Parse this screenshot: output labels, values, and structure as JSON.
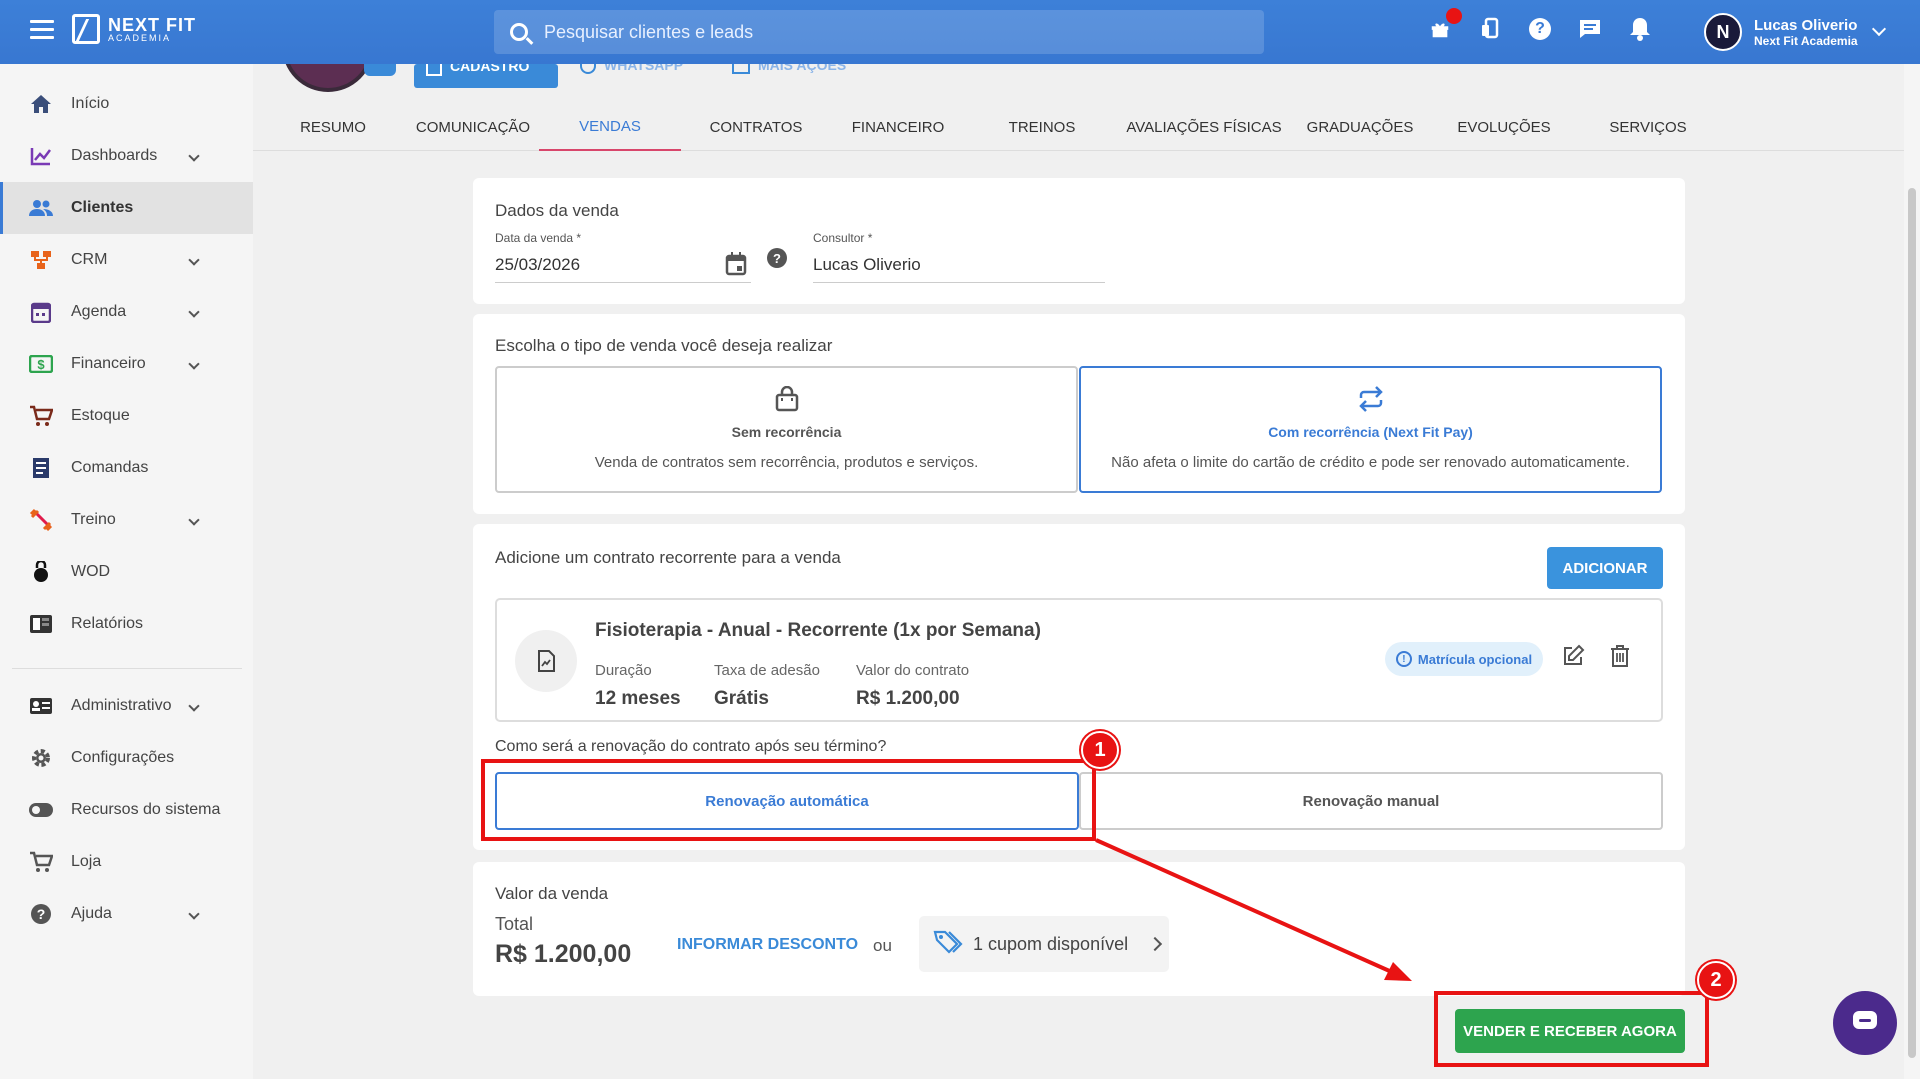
{
  "topbar": {
    "logo_line1": "NEXT FIT",
    "logo_line2": "ACADEMIA",
    "search_placeholder": "Pesquisar clientes e leads",
    "icons": [
      "gift-icon",
      "phone-icon",
      "help-icon",
      "chat-icon",
      "bell-icon"
    ],
    "user_name": "Lucas Oliverio",
    "user_org": "Next Fit Academia",
    "avatar_letter": "N",
    "accent": "#3a7bd5"
  },
  "sidebar": {
    "items": [
      {
        "label": "Início",
        "icon": "home-icon",
        "chevron": false
      },
      {
        "label": "Dashboards",
        "icon": "chart-icon",
        "chevron": true
      },
      {
        "label": "Clientes",
        "icon": "users-icon",
        "chevron": false,
        "active": true
      },
      {
        "label": "CRM",
        "icon": "crm-icon",
        "chevron": true
      },
      {
        "label": "Agenda",
        "icon": "calendar-icon",
        "chevron": true
      },
      {
        "label": "Financeiro",
        "icon": "money-icon",
        "chevron": true
      },
      {
        "label": "Estoque",
        "icon": "cart-icon",
        "chevron": false
      },
      {
        "label": "Comandas",
        "icon": "receipt-icon",
        "chevron": false
      },
      {
        "label": "Treino",
        "icon": "dumbbell-icon",
        "chevron": true
      },
      {
        "label": "WOD",
        "icon": "kettlebell-icon",
        "chevron": false
      },
      {
        "label": "Relatórios",
        "icon": "report-icon",
        "chevron": false
      },
      {
        "label": "Administrativo",
        "icon": "id-card-icon",
        "chevron": true
      },
      {
        "label": "Configurações",
        "icon": "gear-icon",
        "chevron": false
      },
      {
        "label": "Recursos do sistema",
        "icon": "toggle-icon",
        "chevron": false
      },
      {
        "label": "Loja",
        "icon": "cart-icon",
        "chevron": false
      },
      {
        "label": "Ajuda",
        "icon": "help-icon",
        "chevron": true
      }
    ]
  },
  "header_actions": {
    "cadastro": "CADASTRO",
    "whatsapp": "WHATSAPP",
    "mais_acoes": "MAIS AÇÕES"
  },
  "tabs": [
    {
      "label": "RESUMO"
    },
    {
      "label": "COMUNICAÇÃO"
    },
    {
      "label": "VENDAS",
      "active": true
    },
    {
      "label": "CONTRATOS"
    },
    {
      "label": "FINANCEIRO"
    },
    {
      "label": "TREINOS"
    },
    {
      "label": "AVALIAÇÕES FÍSICAS"
    },
    {
      "label": "GRADUAÇÕES"
    },
    {
      "label": "EVOLUÇÕES"
    },
    {
      "label": "SERVIÇOS"
    }
  ],
  "dados_venda": {
    "title": "Dados da venda",
    "date_label": "Data da venda *",
    "date_value": "25/03/2026",
    "consultor_label": "Consultor *",
    "consultor_value": "Lucas Oliverio"
  },
  "tipo_venda": {
    "title": "Escolha o tipo de venda você deseja realizar",
    "options": [
      {
        "title": "Sem recorrência",
        "desc": "Venda de contratos sem recorrência, produtos e serviços.",
        "icon": "bag-icon"
      },
      {
        "title": "Com recorrência (Next Fit Pay)",
        "desc": "Não afeta o limite do cartão de crédito e pode ser renovado automaticamente.",
        "icon": "repeat-icon",
        "selected": true
      }
    ]
  },
  "contrato": {
    "title": "Adicione um contrato recorrente para a venda",
    "add_label": "ADICIONAR",
    "name": "Fisioterapia - Anual - Recorrente (1x por Semana)",
    "duracao_label": "Duração",
    "duracao_value": "12 meses",
    "taxa_label": "Taxa de adesão",
    "taxa_value": "Grátis",
    "valor_label": "Valor do contrato",
    "valor_value": "R$ 1.200,00",
    "badge": "Matrícula opcional",
    "renew_question": "Como será a renovação do contrato após seu término?",
    "renew_auto": "Renovação automática",
    "renew_manual": "Renovação manual"
  },
  "valor_venda": {
    "title": "Valor da venda",
    "total_label": "Total",
    "total_value": "R$ 1.200,00",
    "discount_link": "INFORMAR DESCONTO",
    "or": "ou",
    "coupon": "1 cupom disponível"
  },
  "sell_button": "VENDER E RECEBER AGORA",
  "annotations": {
    "n1": "1",
    "n2": "2",
    "color": "#e81313"
  }
}
